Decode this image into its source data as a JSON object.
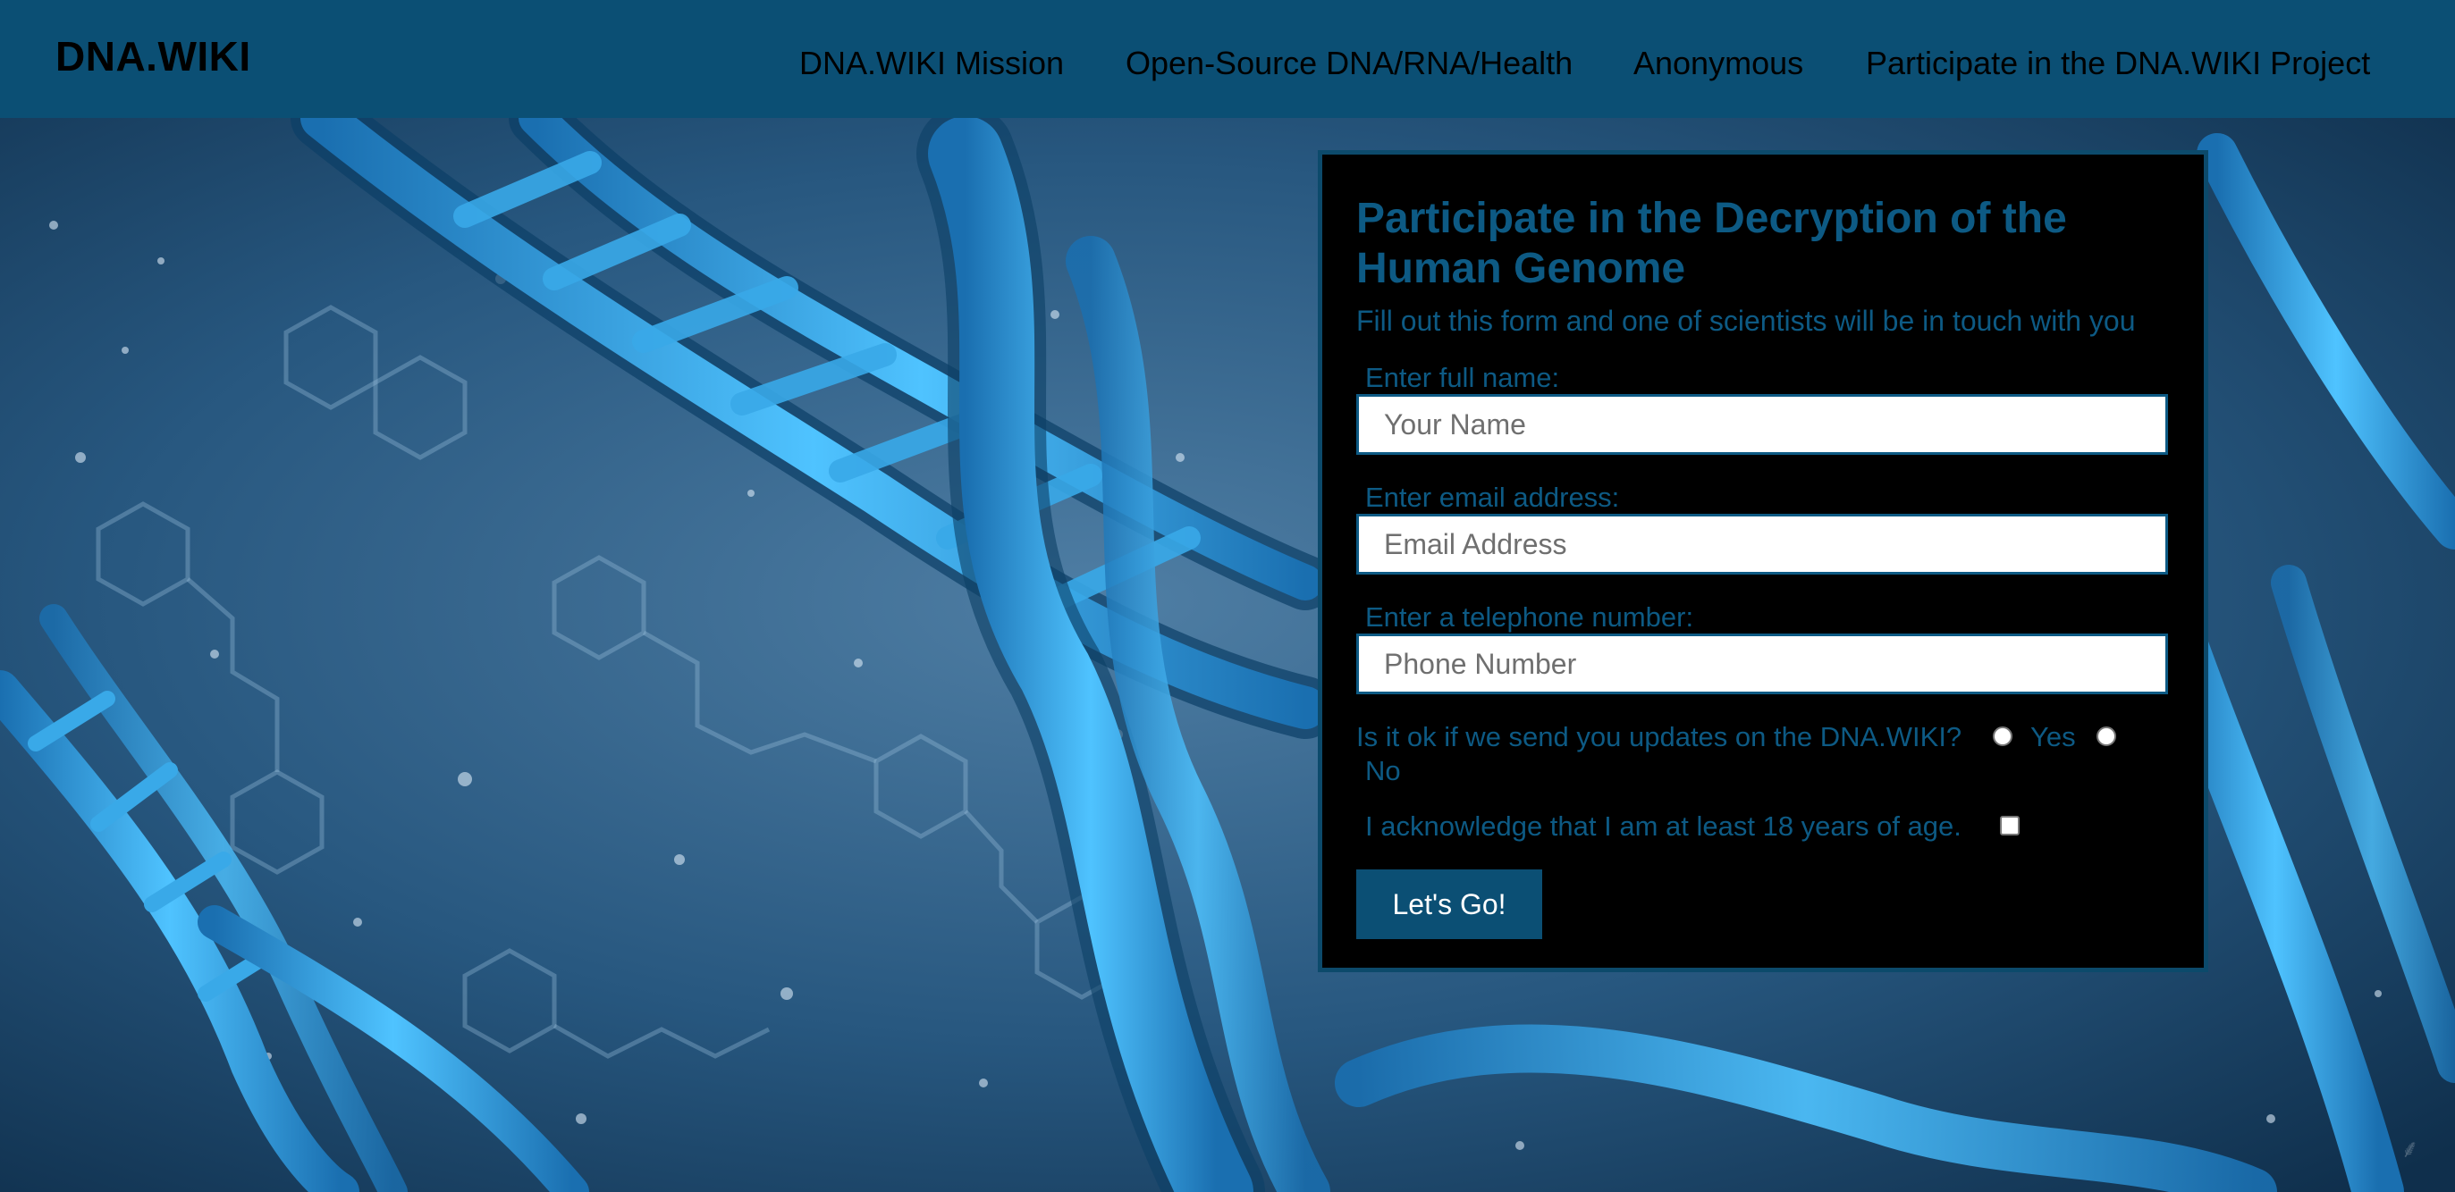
{
  "header": {
    "logo": "DNA.WIKI",
    "nav": [
      {
        "label": "DNA.WIKI Mission"
      },
      {
        "label": "Open-Source DNA/RNA/Health"
      },
      {
        "label": "Anonymous"
      },
      {
        "label": "Participate in the DNA.WIKI Project"
      }
    ]
  },
  "form": {
    "title": "Participate in the Decryption of the Human Genome",
    "subtitle": "Fill out this form and one of scientists will be in touch with you",
    "name_label": "Enter full name:",
    "name_placeholder": "Your Name",
    "email_label": "Enter email address:",
    "email_placeholder": "Email Address",
    "phone_label": "Enter a telephone number:",
    "phone_placeholder": "Phone Number",
    "updates_question": "Is it ok if we send you updates on the DNA.WIKI?",
    "yes_label": "Yes",
    "no_label": "No",
    "age_ack": "I acknowledge that I am at least 18 years of age.",
    "submit_label": "Let's Go!"
  },
  "colors": {
    "header_bg": "#0b4f74",
    "form_text": "#0d5a84",
    "card_bg": "#000000",
    "button_bg": "#0b4f74"
  }
}
